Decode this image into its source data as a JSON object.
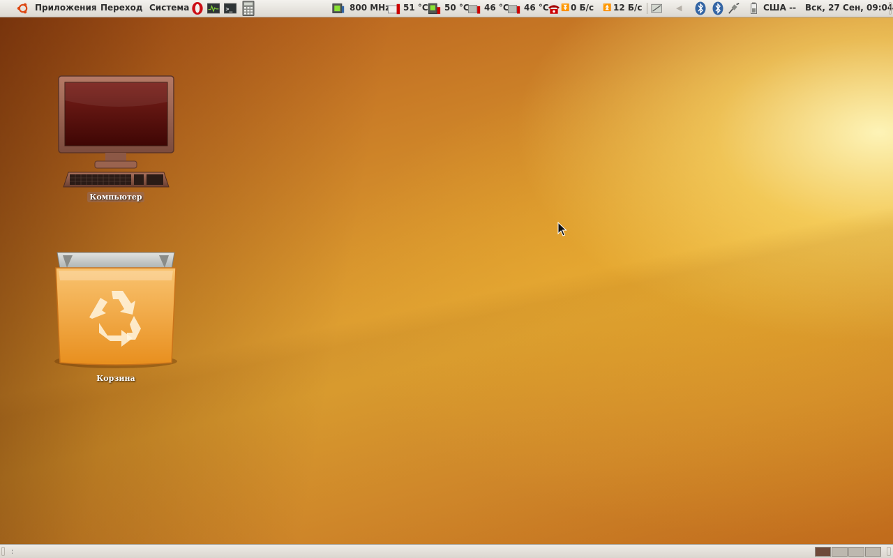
{
  "top_panel": {
    "menus": [
      "Приложения",
      "Переход",
      "Система"
    ],
    "cpu_freq": "800 MHz",
    "temps": [
      "51 °C",
      "50 °C",
      "46 °C",
      "46 °C"
    ],
    "net_down": "0 Б/с",
    "net_up": "12 Б/с",
    "keyboard_layout": "США --",
    "clock": "Вск, 27 Сен, 09:04"
  },
  "desktop": {
    "icons": [
      {
        "label": "Компьютер",
        "icon": "computer-icon"
      },
      {
        "label": "Корзина",
        "icon": "trash-icon"
      }
    ]
  },
  "colors": {
    "panel": "#dcd8d1",
    "wallpaper_accent": "#e3a734"
  }
}
